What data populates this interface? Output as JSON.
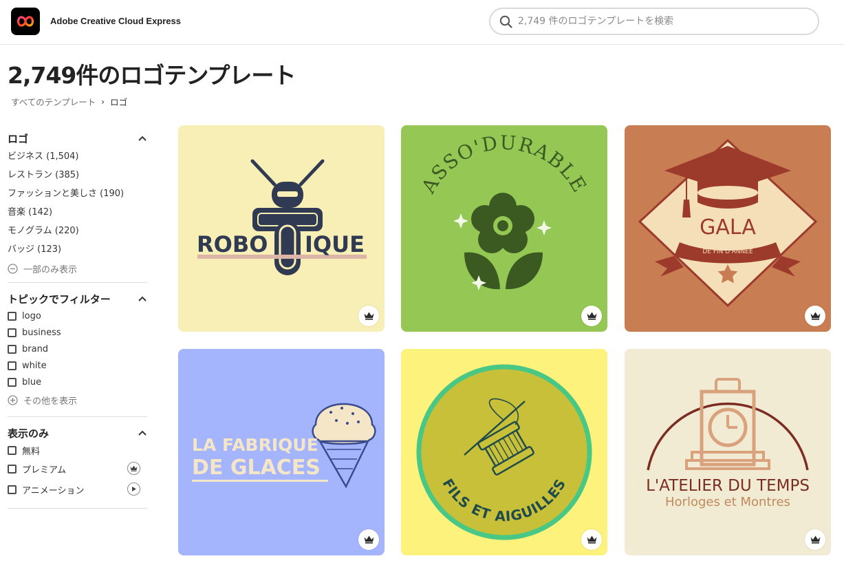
{
  "app": {
    "name": "Adobe Creative Cloud Express",
    "logo_icon": "creative-cloud-logo-icon"
  },
  "search": {
    "placeholder": "2,749 件のロゴテンプレートを検索",
    "value": ""
  },
  "page": {
    "title": "2,749件のロゴテンプレート"
  },
  "breadcrumb": {
    "root": "すべてのテンプレート",
    "separator": "›",
    "current": "ロゴ"
  },
  "sidebar": {
    "categories": {
      "title": "ロゴ",
      "items": [
        {
          "label": "ビジネス (1,504)"
        },
        {
          "label": "レストラン (385)"
        },
        {
          "label": "ファッションと美しさ (190)"
        },
        {
          "label": "音楽 (142)"
        },
        {
          "label": "モノグラム (220)"
        },
        {
          "label": "バッジ (123)"
        }
      ],
      "toggle": "一部のみ表示"
    },
    "topics": {
      "title": "トピックでフィルター",
      "items": [
        {
          "label": "logo"
        },
        {
          "label": "business"
        },
        {
          "label": "brand"
        },
        {
          "label": "white"
        },
        {
          "label": "blue"
        }
      ],
      "toggle": "その他を表示"
    },
    "display": {
      "title": "表示のみ",
      "items": [
        {
          "label": "無料",
          "badge": null
        },
        {
          "label": "プレミアム",
          "badge": "crown-icon"
        },
        {
          "label": "アニメーション",
          "badge": "play-icon"
        }
      ]
    }
  },
  "templates": [
    {
      "bg": "#f7efb5",
      "text": "ROBOTIQUE",
      "part1": "ROBO",
      "part2": "IQUE",
      "premium": true
    },
    {
      "bg": "#94c753",
      "text": "ASSO'DURABLE",
      "premium": true
    },
    {
      "bg": "#c97d52",
      "text": "GALA",
      "subtext": "DE FIN D'ANNÉE",
      "premium": true
    },
    {
      "bg": "#a4b5fd",
      "text": "LA FABRIQUE",
      "text2": "DE GLACES",
      "premium": true
    },
    {
      "bg": "#fdf27c",
      "text": "FILS ET AIGUILLES",
      "premium": true
    },
    {
      "bg": "#f2ebd3",
      "text": "L'ATELIER DU TEMPS",
      "subtext": "Horloges et Montres",
      "premium": true
    }
  ]
}
